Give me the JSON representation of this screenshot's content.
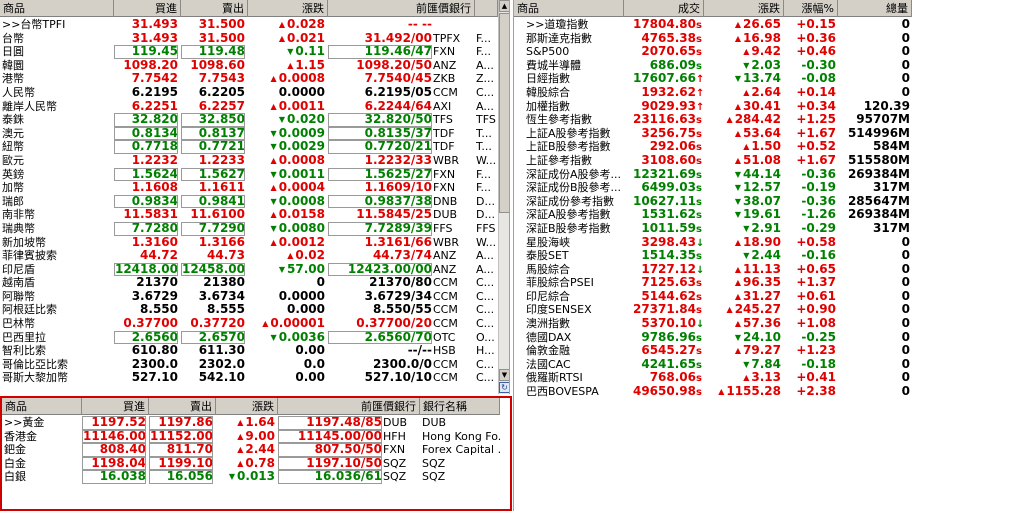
{
  "fx": {
    "headers": {
      "name": "商品",
      "bid": "買進",
      "ask": "賣出",
      "chg": "漲跌",
      "prev": "前匯價銀行",
      "extra": ""
    },
    "rows": [
      {
        "name": ">>台幣TPFI",
        "bid": "31.493",
        "ask": "31.500",
        "dir": "up",
        "chg": "0.028",
        "prev": "-- --",
        "bank": "",
        "extra": ""
      },
      {
        "name": "台幣",
        "bid": "31.493",
        "ask": "31.500",
        "dir": "up",
        "chg": "0.021",
        "prev": "31.492/00",
        "bank": "TPFX",
        "extra": "F..."
      },
      {
        "name": "日圓",
        "bid": "119.45",
        "ask": "119.48",
        "dir": "dn",
        "chg": "0.11",
        "prev": "119.46/47",
        "bank": "FXN",
        "extra": "F..."
      },
      {
        "name": "韓圜",
        "bid": "1098.20",
        "ask": "1098.60",
        "dir": "up",
        "chg": "1.15",
        "prev": "1098.20/50",
        "bank": "ANZ",
        "extra": "A..."
      },
      {
        "name": "港幣",
        "bid": "7.7542",
        "ask": "7.7543",
        "dir": "up",
        "chg": "0.0008",
        "prev": "7.7540/45",
        "bank": "ZKB",
        "extra": "Z..."
      },
      {
        "name": "人民幣",
        "bid": "6.2195",
        "ask": "6.2205",
        "dir": "eq",
        "chg": "0.0000",
        "prev": "6.2195/05",
        "bank": "CCM",
        "extra": "C..."
      },
      {
        "name": "離岸人民幣",
        "bid": "6.2251",
        "ask": "6.2257",
        "dir": "up",
        "chg": "0.0011",
        "prev": "6.2244/64",
        "bank": "AXI",
        "extra": "A..."
      },
      {
        "name": "泰銖",
        "bid": "32.820",
        "ask": "32.850",
        "dir": "dn",
        "chg": "0.020",
        "prev": "32.820/50",
        "bank": "TFS",
        "extra": "TFS"
      },
      {
        "name": "澳元",
        "bid": "0.8134",
        "ask": "0.8137",
        "dir": "dn",
        "chg": "0.0009",
        "prev": "0.8135/37",
        "bank": "TDF",
        "extra": "T..."
      },
      {
        "name": "紐幣",
        "bid": "0.7718",
        "ask": "0.7721",
        "dir": "dn",
        "chg": "0.0029",
        "prev": "0.7720/21",
        "bank": "TDF",
        "extra": "T..."
      },
      {
        "name": "歐元",
        "bid": "1.2232",
        "ask": "1.2233",
        "dir": "up",
        "chg": "0.0008",
        "prev": "1.2232/33",
        "bank": "WBR",
        "extra": "W..."
      },
      {
        "name": "英鎊",
        "bid": "1.5624",
        "ask": "1.5627",
        "dir": "dn",
        "chg": "0.0011",
        "prev": "1.5625/27",
        "bank": "FXN",
        "extra": "F..."
      },
      {
        "name": "加幣",
        "bid": "1.1608",
        "ask": "1.1611",
        "dir": "up",
        "chg": "0.0004",
        "prev": "1.1609/10",
        "bank": "FXN",
        "extra": "F..."
      },
      {
        "name": "瑞郎",
        "bid": "0.9834",
        "ask": "0.9841",
        "dir": "dn",
        "chg": "0.0008",
        "prev": "0.9837/38",
        "bank": "DNB",
        "extra": "D..."
      },
      {
        "name": "南非幣",
        "bid": "11.5831",
        "ask": "11.6100",
        "dir": "up",
        "chg": "0.0158",
        "prev": "11.5845/25",
        "bank": "DUB",
        "extra": "D..."
      },
      {
        "name": "瑞典幣",
        "bid": "7.7280",
        "ask": "7.7290",
        "dir": "dn",
        "chg": "0.0080",
        "prev": "7.7289/39",
        "bank": "FFS",
        "extra": "FFS"
      },
      {
        "name": "新加坡幣",
        "bid": "1.3160",
        "ask": "1.3166",
        "dir": "up",
        "chg": "0.0012",
        "prev": "1.3161/66",
        "bank": "WBR",
        "extra": "W..."
      },
      {
        "name": "菲律賓披索",
        "bid": "44.72",
        "ask": "44.73",
        "dir": "up",
        "chg": "0.02",
        "prev": "44.73/74",
        "bank": "ANZ",
        "extra": "A..."
      },
      {
        "name": "印尼盾",
        "bid": "12418.00",
        "ask": "12458.00",
        "dir": "dn",
        "chg": "57.00",
        "prev": "12423.00/00",
        "bank": "ANZ",
        "extra": "A..."
      },
      {
        "name": "越南盾",
        "bid": "21370",
        "ask": "21380",
        "dir": "eq",
        "chg": "0",
        "prev": "21370/80",
        "bank": "CCM",
        "extra": "C..."
      },
      {
        "name": "阿聯幣",
        "bid": "3.6729",
        "ask": "3.6734",
        "dir": "eq",
        "chg": "0.0000",
        "prev": "3.6729/34",
        "bank": "CCM",
        "extra": "C..."
      },
      {
        "name": "阿根廷比索",
        "bid": "8.550",
        "ask": "8.555",
        "dir": "eq",
        "chg": "0.000",
        "prev": "8.550/55",
        "bank": "CCM",
        "extra": "C..."
      },
      {
        "name": "巴林幣",
        "bid": "0.37700",
        "ask": "0.37720",
        "dir": "up",
        "chg": "0.00001",
        "prev": "0.37700/20",
        "bank": "CCM",
        "extra": "C..."
      },
      {
        "name": "巴西里拉",
        "bid": "2.6560",
        "ask": "2.6570",
        "dir": "dn",
        "chg": "0.0036",
        "prev": "2.6560/70",
        "bank": "OTC",
        "extra": "O..."
      },
      {
        "name": "智利比索",
        "bid": "610.80",
        "ask": "611.30",
        "dir": "eq",
        "chg": "0.00",
        "prev": "--/--",
        "bank": "HSB",
        "extra": "H..."
      },
      {
        "name": "哥倫比亞比索",
        "bid": "2300.0",
        "ask": "2302.0",
        "dir": "eq",
        "chg": "0.0",
        "prev": "2300.0/0",
        "bank": "CCM",
        "extra": "C..."
      },
      {
        "name": "哥斯大黎加幣",
        "bid": "527.10",
        "ask": "542.10",
        "dir": "eq",
        "chg": "0.00",
        "prev": "527.10/10",
        "bank": "CCM",
        "extra": "C..."
      }
    ]
  },
  "metals": {
    "headers": {
      "name": "商品",
      "bid": "買進",
      "ask": "賣出",
      "chg": "漲跌",
      "prev": "前匯價銀行",
      "bankname": "銀行名稱"
    },
    "rows": [
      {
        "name": ">>黃金",
        "bid": "1197.52",
        "ask": "1197.86",
        "dir": "up",
        "chg": "1.64",
        "prev": "1197.48/85",
        "bank": "DUB",
        "bankname": "DUB"
      },
      {
        "name": "香港金",
        "bid": "11146.00",
        "ask": "11152.00",
        "dir": "up",
        "chg": "9.00",
        "prev": "11145.00/00",
        "bank": "HFH",
        "bankname": "Hong Kong Fo..."
      },
      {
        "name": "鈀金",
        "bid": "808.40",
        "ask": "811.70",
        "dir": "up",
        "chg": "2.44",
        "prev": "807.50/50",
        "bank": "FXN",
        "bankname": "Forex Capital ..."
      },
      {
        "name": "白金",
        "bid": "1198.04",
        "ask": "1199.10",
        "dir": "up",
        "chg": "0.78",
        "prev": "1197.10/50",
        "bank": "SQZ",
        "bankname": "SQZ"
      },
      {
        "name": "白銀",
        "bid": "16.038",
        "ask": "16.056",
        "dir": "dn",
        "chg": "0.013",
        "prev": "16.036/61",
        "bank": "SQZ",
        "bankname": "SQZ"
      }
    ]
  },
  "indices": {
    "headers": {
      "name": "商品",
      "deal": "成交",
      "chg": "漲跌",
      "pct": "漲幅%",
      "vol": "總量"
    },
    "rows": [
      {
        "name": ">>道瓊指數",
        "deal": "17804.80",
        "mark": "s",
        "dir": "up",
        "chg": "26.65",
        "pct": "+0.15",
        "vol": "0"
      },
      {
        "name": "那斯達克指數",
        "deal": "4765.38",
        "mark": "s",
        "dir": "up",
        "chg": "16.98",
        "pct": "+0.36",
        "vol": "0"
      },
      {
        "name": "S&P500",
        "deal": "2070.65",
        "mark": "s",
        "dir": "up",
        "chg": "9.42",
        "pct": "+0.46",
        "vol": "0"
      },
      {
        "name": "費城半導體",
        "deal": "686.09",
        "mark": "s",
        "dir": "dn",
        "chg": "2.03",
        "pct": "-0.30",
        "vol": "0"
      },
      {
        "name": "日經指數",
        "deal": "17607.66",
        "mark": "↑",
        "dir": "dn",
        "chg": "13.74",
        "pct": "-0.08",
        "vol": "0"
      },
      {
        "name": "韓股綜合",
        "deal": "1932.62",
        "mark": "↑",
        "dir": "up",
        "chg": "2.64",
        "pct": "+0.14",
        "vol": "0"
      },
      {
        "name": "加權指數",
        "deal": "9029.93",
        "mark": "↑",
        "dir": "up",
        "chg": "30.41",
        "pct": "+0.34",
        "vol": "120.39"
      },
      {
        "name": "恆生參考指數",
        "deal": "23116.63",
        "mark": "s",
        "dir": "up",
        "chg": "284.42",
        "pct": "+1.25",
        "vol": "95707M"
      },
      {
        "name": "上証A股參考指數",
        "deal": "3256.75",
        "mark": "s",
        "dir": "up",
        "chg": "53.64",
        "pct": "+1.67",
        "vol": "514996M"
      },
      {
        "name": "上証B股參考指數",
        "deal": "292.06",
        "mark": "s",
        "dir": "up",
        "chg": "1.50",
        "pct": "+0.52",
        "vol": "584M"
      },
      {
        "name": "上証參考指數",
        "deal": "3108.60",
        "mark": "s",
        "dir": "up",
        "chg": "51.08",
        "pct": "+1.67",
        "vol": "515580M"
      },
      {
        "name": "深証成份A股參考...",
        "deal": "12321.69",
        "mark": "s",
        "dir": "dn",
        "chg": "44.14",
        "pct": "-0.36",
        "vol": "269384M"
      },
      {
        "name": "深証成份B股參考...",
        "deal": "6499.03",
        "mark": "s",
        "dir": "dn",
        "chg": "12.57",
        "pct": "-0.19",
        "vol": "317M"
      },
      {
        "name": "深証成份參考指數",
        "deal": "10627.11",
        "mark": "s",
        "dir": "dn",
        "chg": "38.07",
        "pct": "-0.36",
        "vol": "285647M"
      },
      {
        "name": "深証A股參考指數",
        "deal": "1531.62",
        "mark": "s",
        "dir": "dn",
        "chg": "19.61",
        "pct": "-1.26",
        "vol": "269384M"
      },
      {
        "name": "深証B股參考指數",
        "deal": "1011.59",
        "mark": "s",
        "dir": "dn",
        "chg": "2.91",
        "pct": "-0.29",
        "vol": "317M"
      },
      {
        "name": "星股海峽",
        "deal": "3298.43",
        "mark": "↓",
        "dir": "up",
        "chg": "18.90",
        "pct": "+0.58",
        "vol": "0"
      },
      {
        "name": "泰股SET",
        "deal": "1514.35",
        "mark": "s",
        "dir": "dn",
        "chg": "2.44",
        "pct": "-0.16",
        "vol": "0"
      },
      {
        "name": "馬股綜合",
        "deal": "1727.12",
        "mark": "↓",
        "dir": "up",
        "chg": "11.13",
        "pct": "+0.65",
        "vol": "0"
      },
      {
        "name": "菲股綜合PSEI",
        "deal": "7125.63",
        "mark": "s",
        "dir": "up",
        "chg": "96.35",
        "pct": "+1.37",
        "vol": "0"
      },
      {
        "name": "印尼綜合",
        "deal": "5144.62",
        "mark": "s",
        "dir": "up",
        "chg": "31.27",
        "pct": "+0.61",
        "vol": "0"
      },
      {
        "name": "印度SENSEX",
        "deal": "27371.84",
        "mark": "s",
        "dir": "up",
        "chg": "245.27",
        "pct": "+0.90",
        "vol": "0"
      },
      {
        "name": "澳洲指數",
        "deal": "5370.10",
        "mark": "↓",
        "dir": "up",
        "chg": "57.36",
        "pct": "+1.08",
        "vol": "0"
      },
      {
        "name": "德國DAX",
        "deal": "9786.96",
        "mark": "s",
        "dir": "dn",
        "chg": "24.10",
        "pct": "-0.25",
        "vol": "0"
      },
      {
        "name": "倫敦金融",
        "deal": "6545.27",
        "mark": "s",
        "dir": "up",
        "chg": "79.27",
        "pct": "+1.23",
        "vol": "0"
      },
      {
        "name": "法國CAC",
        "deal": "4241.65",
        "mark": "s",
        "dir": "dn",
        "chg": "7.84",
        "pct": "-0.18",
        "vol": "0"
      },
      {
        "name": "俄羅斯RTSI",
        "deal": "768.06",
        "mark": "s",
        "dir": "up",
        "chg": "3.13",
        "pct": "+0.41",
        "vol": "0"
      },
      {
        "name": "巴西BOVESPA",
        "deal": "49650.98",
        "mark": "s",
        "dir": "up",
        "chg": "1155.28",
        "pct": "+2.38",
        "vol": "0"
      }
    ]
  },
  "colors": {
    "up": "#e00000",
    "down": "#008000",
    "header_bg": "#d4d0c8",
    "metal_border": "#d00000"
  },
  "icons": {
    "up_triangle": "▲",
    "down_triangle": "▼",
    "scroll_up": "▲",
    "scroll_down": "▼"
  }
}
